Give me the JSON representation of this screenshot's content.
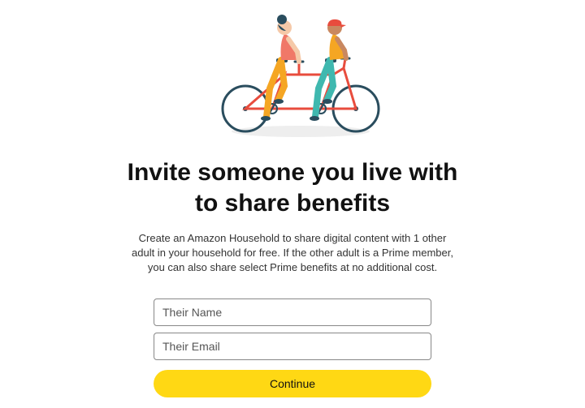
{
  "heading": "Invite someone you live with to share benefits",
  "description": "Create an Amazon Household to share digital content with 1 other adult in your household for free. If the other adult is a Prime member, you can also share select Prime benefits at no additional cost.",
  "form": {
    "name_placeholder": "Their Name",
    "email_placeholder": "Their Email",
    "continue_label": "Continue"
  },
  "illustration": {
    "name": "tandem-bike-illustration"
  }
}
